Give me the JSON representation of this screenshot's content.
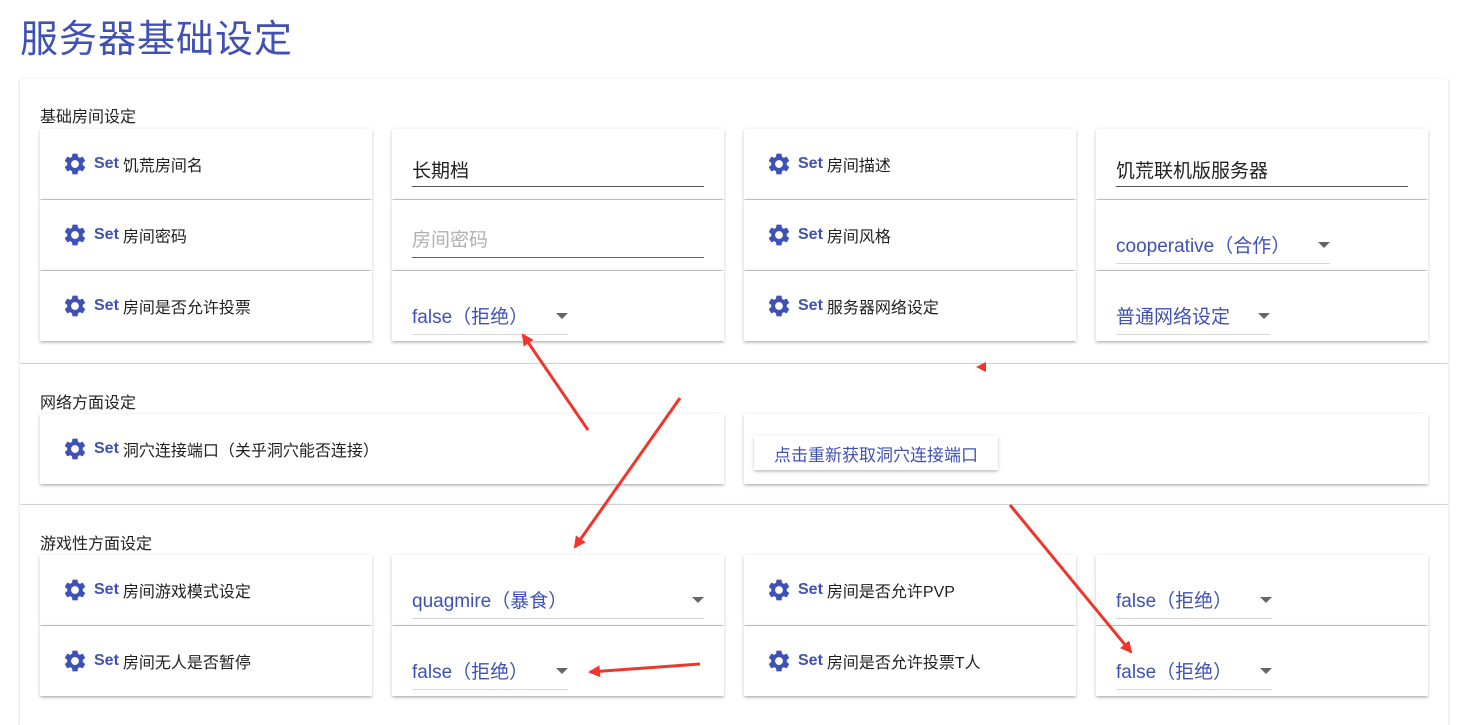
{
  "page_title": "服务器基础设定",
  "set_word": "Set",
  "sections": {
    "basic": {
      "title": "基础房间设定",
      "room_name_label": "饥荒房间名",
      "room_name_value": "长期档",
      "room_desc_label": "房间描述",
      "room_desc_value": "饥荒联机版服务器",
      "room_password_label": "房间密码",
      "room_password_placeholder": "房间密码",
      "room_style_label": "房间风格",
      "room_style_value": "cooperative（合作）",
      "room_vote_label": "房间是否允许投票",
      "room_vote_value": "false（拒绝）",
      "network_label": "服务器网络设定",
      "network_value": "普通网络设定"
    },
    "network": {
      "title": "网络方面设定",
      "cave_port_label": "洞穴连接端口（关乎洞穴能否连接）",
      "refresh_button": "点击重新获取洞穴连接端口"
    },
    "gameplay": {
      "title": "游戏性方面设定",
      "game_mode_label": "房间游戏模式设定",
      "game_mode_value": "quagmire（暴食）",
      "pvp_label": "房间是否允许PVP",
      "pvp_value": "false（拒绝）",
      "pause_label": "房间无人是否暂停",
      "pause_value": "false（拒绝）",
      "vote_kick_label": "房间是否允许投票T人",
      "vote_kick_value": "false（拒绝）"
    }
  },
  "colors": {
    "accent": "#3f51b5",
    "annotation_arrow": "#f0352b"
  },
  "icons": {
    "setting": "gear-icon",
    "dropdown": "caret-down-icon"
  }
}
